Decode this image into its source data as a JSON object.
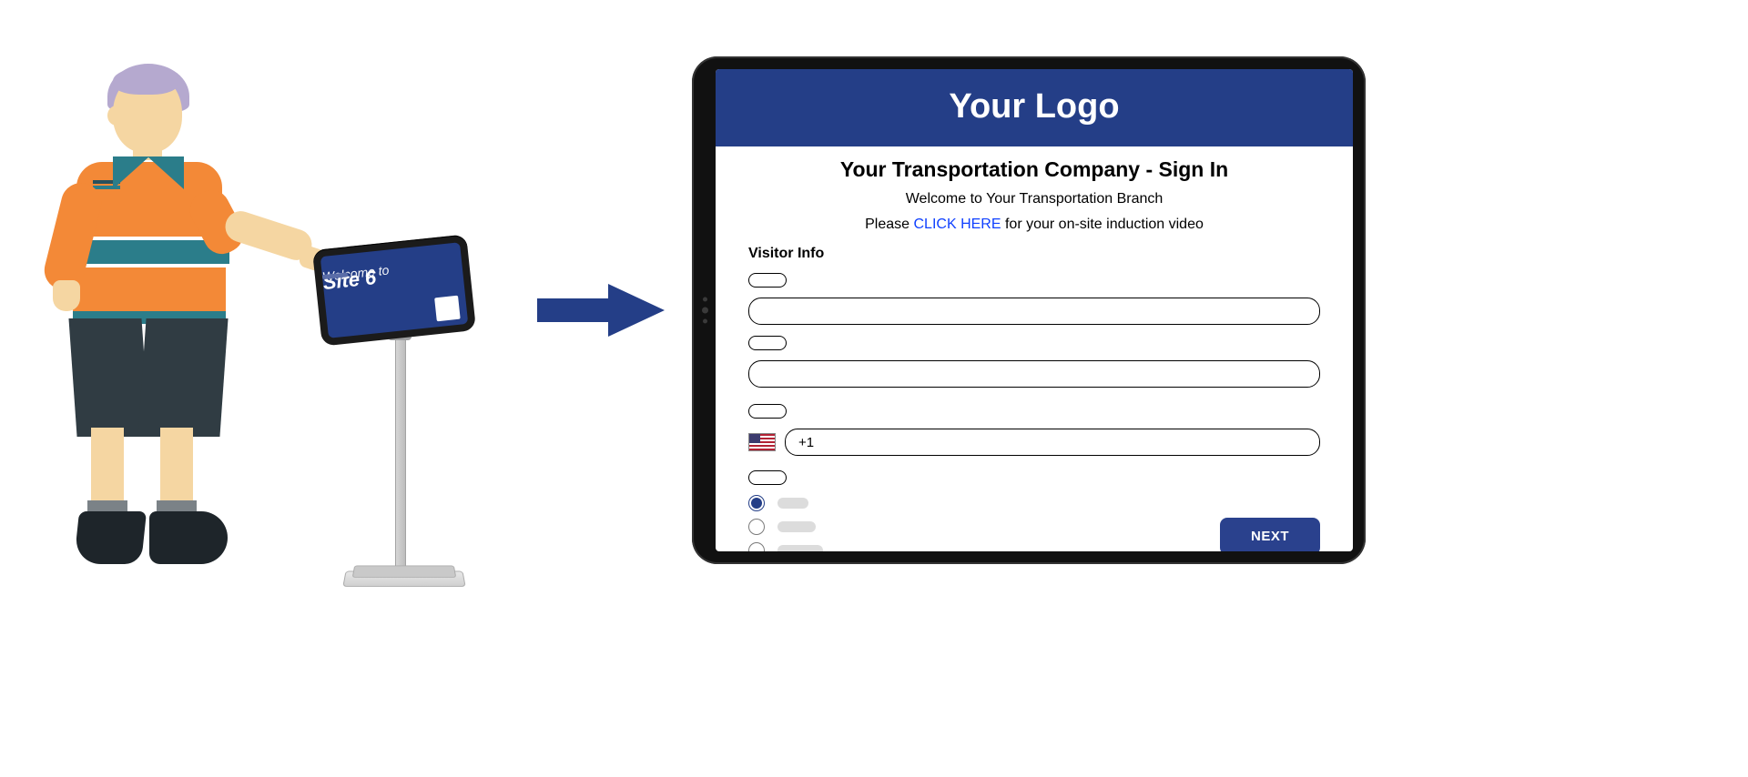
{
  "colors": {
    "brand_blue": "#243e87",
    "link_blue": "#0f40ff",
    "orange": "#f38937",
    "teal": "#2b7d8a"
  },
  "kiosk": {
    "line1": "Welcome to",
    "line2": "Site 6"
  },
  "tablet": {
    "header": "Your Logo",
    "title": "Your Transportation Company - Sign In",
    "subtitle": "Welcome to Your Transportation Branch",
    "induction_prefix": "Please ",
    "induction_link": "CLICK HERE",
    "induction_suffix": " for your on-site induction video",
    "section_label": "Visitor Info",
    "phone_prefix": "+1",
    "next_label": "NEXT",
    "radio_selected_index": 0,
    "radio_options": [
      "",
      "",
      ""
    ]
  }
}
